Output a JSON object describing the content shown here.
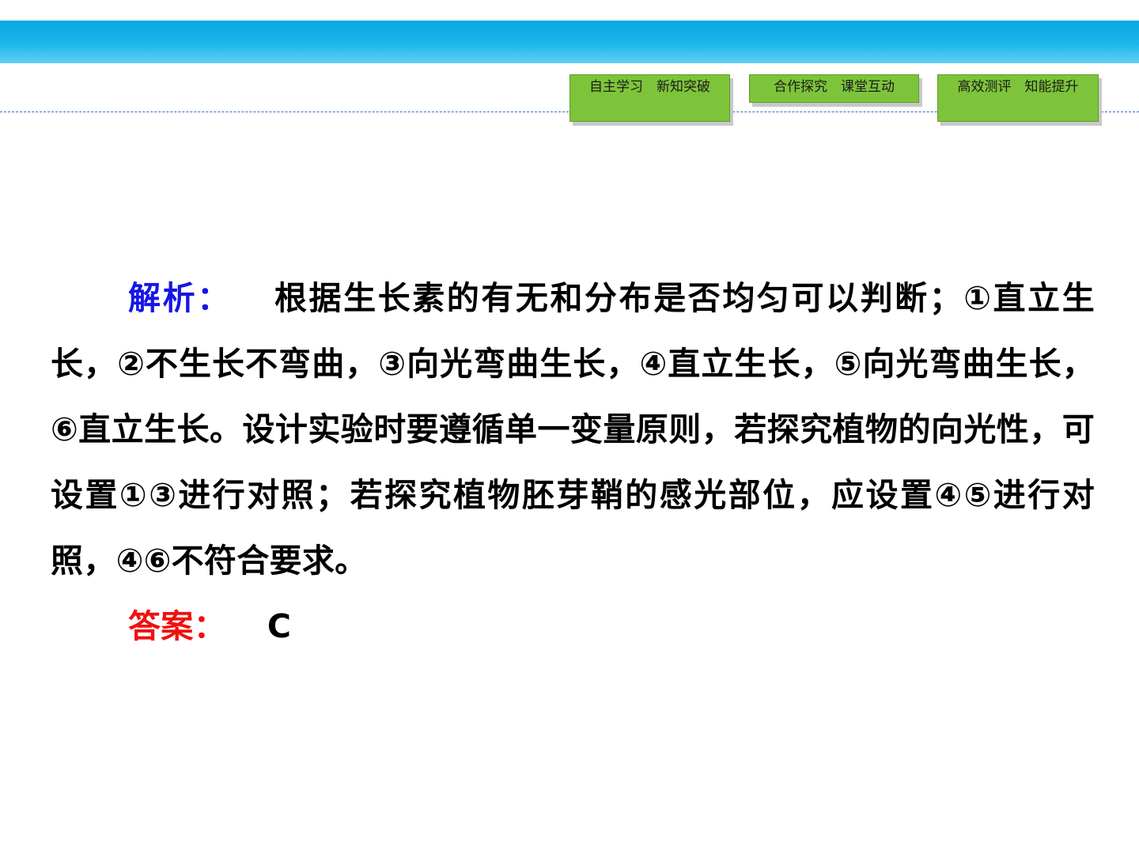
{
  "nav": {
    "tabs": [
      {
        "label": "自主学习　新知突破"
      },
      {
        "label": "合作探究　课堂互动"
      },
      {
        "label": "高效测评　知能提升"
      }
    ]
  },
  "analysis": {
    "label": "解析：",
    "text": "根据生长素的有无和分布是否均匀可以判断；①直立生长，②不生长不弯曲，③向光弯曲生长，④直立生长，⑤向光弯曲生长，⑥直立生长。设计实验时要遵循单一变量原则，若探究植物的向光性，可设置①③进行对照；若探究植物胚芽鞘的感光部位，应设置④⑤进行对照，④⑥不符合要求。"
  },
  "answer": {
    "label": "答案：",
    "value": "C"
  },
  "colors": {
    "top_band": "#1bb6ec",
    "tab_fill": "#7dc43a",
    "analysis_label": "#1515e8",
    "answer_label": "#f01010",
    "dash_line": "#2f6fd6"
  }
}
